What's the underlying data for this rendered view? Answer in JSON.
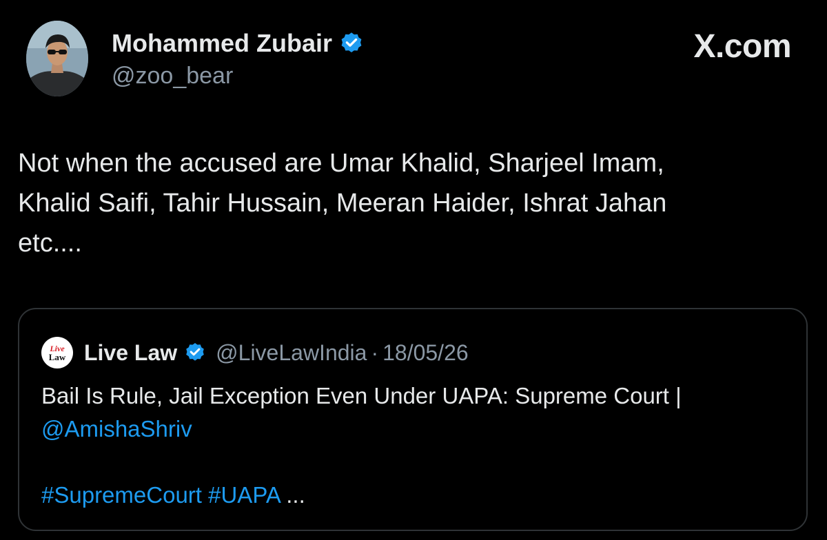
{
  "author": {
    "display_name": "Mohammed Zubair",
    "handle": "@zoo_bear",
    "verified": true,
    "avatar_icon": "user-photo-icon"
  },
  "brand": {
    "label": "X.com"
  },
  "tweet": {
    "lines": [
      "Not when the accused are Umar Khalid, Sharjeel Imam,",
      "Khalid Saifi, Tahir Hussain, Meeran Haider, Ishrat Jahan",
      "etc...."
    ]
  },
  "quote": {
    "logo_line1": "Live",
    "logo_line2": "Law",
    "name": "Live Law",
    "verified": true,
    "handle": "@LiveLawIndia",
    "separator": "·",
    "date": "18/05/26",
    "text_line1": "Bail Is Rule, Jail Exception Even Under UAPA: Supreme Court |",
    "mention": "@AmishaShriv",
    "hashtag1": "#SupremeCourt",
    "hashtag2": "#UAPA",
    "ellipsis": " ..."
  },
  "colors": {
    "background": "#000000",
    "text": "#e7e9ea",
    "secondary": "#8b98a5",
    "link": "#1d9bf0",
    "border": "#2f3336"
  }
}
